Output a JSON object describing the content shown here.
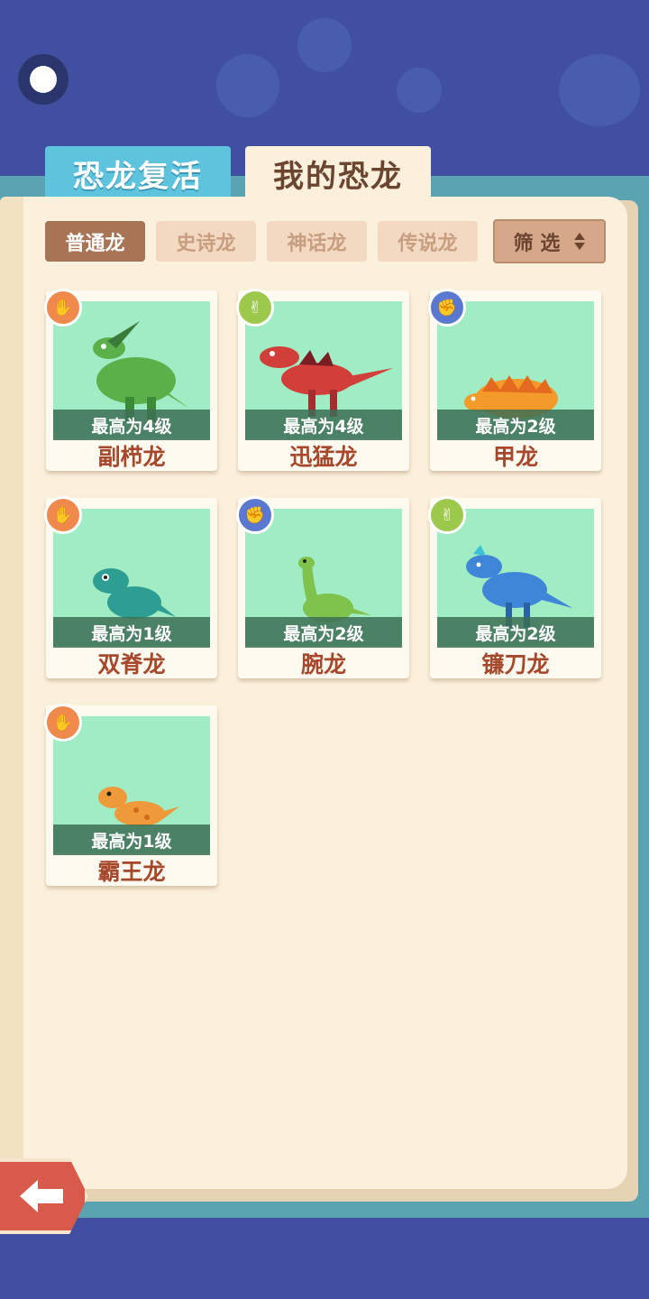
{
  "tabs": {
    "revive": "恐龙复活",
    "mine": "我的恐龙"
  },
  "filters": {
    "items": [
      "普通龙",
      "史诗龙",
      "神话龙",
      "传说龙"
    ],
    "active_index": 0,
    "filter_button": "筛 选"
  },
  "dinosaurs": [
    {
      "name": "副栉龙",
      "level": "最高为4级",
      "badge": "palm-icon",
      "badge_color": "#f08a4c",
      "body_color": "#5bb04a"
    },
    {
      "name": "迅猛龙",
      "level": "最高为4级",
      "badge": "scissors-icon",
      "badge_color": "#9cc84c",
      "body_color": "#d23f3a"
    },
    {
      "name": "甲龙",
      "level": "最高为2级",
      "badge": "fist-icon",
      "badge_color": "#5b78d0",
      "body_color": "#f39a2a"
    },
    {
      "name": "双脊龙",
      "level": "最高为1级",
      "badge": "palm-icon",
      "badge_color": "#f08a4c",
      "body_color": "#2e9e92"
    },
    {
      "name": "腕龙",
      "level": "最高为2级",
      "badge": "fist-icon",
      "badge_color": "#5b78d0",
      "body_color": "#7fc34c"
    },
    {
      "name": "镰刀龙",
      "level": "最高为2级",
      "badge": "scissors-icon",
      "badge_color": "#9cc84c",
      "body_color": "#3f86d8"
    },
    {
      "name": "霸王龙",
      "level": "最高为1级",
      "badge": "palm-icon",
      "badge_color": "#f08a4c",
      "body_color": "#ef9a3a"
    }
  ],
  "colors": {
    "background": "#414fa0",
    "book": "#fbf0dc",
    "accent_teal": "#5ec4de",
    "active_filter": "#a87456",
    "name_text": "#a6482c"
  }
}
